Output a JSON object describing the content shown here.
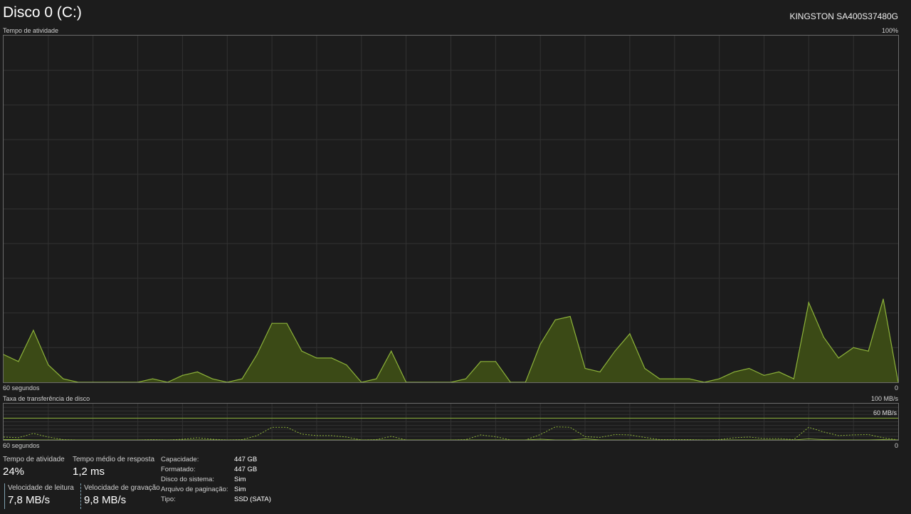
{
  "header": {
    "title": "Disco 0 (C:)",
    "model": "KINGSTON SA400S37480G"
  },
  "activity_chart": {
    "label": "Tempo de atividade",
    "max_label": "100%",
    "left_axis": "60 segundos",
    "right_axis": "0"
  },
  "transfer_chart": {
    "label": "Taxa de transferência de disco",
    "max_label": "100 MB/s",
    "ref_label": "60 MB/s",
    "left_axis": "60 segundos",
    "right_axis": "0"
  },
  "stats": {
    "activity_label": "Tempo de atividade",
    "activity_value": "24%",
    "response_label": "Tempo médio de resposta",
    "response_value": "1,2 ms",
    "read_label": "Velocidade de leitura",
    "read_value": "7,8 MB/s",
    "write_label": "Velocidade de gravação",
    "write_value": "9,8 MB/s"
  },
  "properties": [
    {
      "key": "Capacidade:",
      "value": "447 GB"
    },
    {
      "key": "Formatado:",
      "value": "447 GB"
    },
    {
      "key": "Disco do sistema:",
      "value": "Sim"
    },
    {
      "key": "Arquivo de paginação:",
      "value": "Sim"
    },
    {
      "key": "Tipo:",
      "value": "SSD (SATA)"
    }
  ],
  "colors": {
    "accent_line": "#8db33a",
    "accent_fill": "#3b4a16",
    "grid": "#323232",
    "background": "#1c1c1c"
  },
  "chart_data": [
    {
      "type": "area",
      "title": "Tempo de atividade",
      "xlabel": "60 segundos",
      "ylim": [
        0,
        100
      ],
      "x": [
        0,
        1,
        2,
        3,
        4,
        5,
        6,
        7,
        8,
        9,
        10,
        11,
        12,
        13,
        14,
        15,
        16,
        17,
        18,
        19,
        20,
        21,
        22,
        23,
        24,
        25,
        26,
        27,
        28,
        29,
        30,
        31,
        32,
        33,
        34,
        35,
        36,
        37,
        38,
        39,
        40,
        41,
        42,
        43,
        44,
        45,
        46,
        47,
        48,
        49,
        50,
        51,
        52,
        53,
        54,
        55,
        56,
        57,
        58,
        59,
        60
      ],
      "series": [
        {
          "values": [
            8,
            6,
            15,
            5,
            1,
            0,
            0,
            0,
            0,
            0,
            1,
            0,
            2,
            3,
            1,
            0,
            1,
            8,
            17,
            17,
            9,
            7,
            7,
            5,
            0,
            1,
            9,
            0,
            0,
            0,
            0,
            1,
            6,
            6,
            0,
            0,
            11,
            18,
            19,
            4,
            3,
            9,
            14,
            4,
            1,
            1,
            1,
            0,
            1,
            3,
            4,
            2,
            3,
            1,
            23,
            13,
            7,
            10,
            9,
            24,
            0
          ]
        }
      ]
    },
    {
      "type": "line",
      "title": "Taxa de transferência de disco",
      "xlabel": "60 segundos",
      "ylim": [
        0,
        100
      ],
      "reference_line": 60,
      "x": [
        0,
        1,
        2,
        3,
        4,
        5,
        6,
        7,
        8,
        9,
        10,
        11,
        12,
        13,
        14,
        15,
        16,
        17,
        18,
        19,
        20,
        21,
        22,
        23,
        24,
        25,
        26,
        27,
        28,
        29,
        30,
        31,
        32,
        33,
        34,
        35,
        36,
        37,
        38,
        39,
        40,
        41,
        42,
        43,
        44,
        45,
        46,
        47,
        48,
        49,
        50,
        51,
        52,
        53,
        54,
        55,
        56,
        57,
        58,
        59,
        60
      ],
      "series": [
        {
          "name": "Velocidade de leitura",
          "values": [
            1,
            1,
            0,
            0,
            0,
            0,
            0,
            0,
            0,
            0,
            0,
            0,
            0,
            0,
            0,
            0,
            0,
            0,
            0,
            0,
            0,
            0,
            0,
            0,
            0,
            0,
            0,
            0,
            0,
            0,
            0,
            0,
            0,
            0,
            0,
            0,
            2,
            0,
            0,
            3,
            0,
            0,
            0,
            0,
            0,
            0,
            0,
            0,
            0,
            0,
            0,
            0,
            0,
            0,
            3,
            1,
            0,
            0,
            0,
            1,
            0
          ]
        },
        {
          "name": "Velocidade de gravação",
          "values": [
            8,
            6,
            18,
            8,
            1,
            0,
            0,
            0,
            0,
            0,
            1,
            0,
            2,
            6,
            2,
            0,
            1,
            12,
            35,
            35,
            16,
            12,
            12,
            8,
            0,
            1,
            10,
            0,
            0,
            0,
            0,
            1,
            14,
            9,
            0,
            0,
            15,
            36,
            35,
            9,
            7,
            15,
            14,
            7,
            1,
            1,
            1,
            0,
            1,
            6,
            8,
            4,
            4,
            1,
            35,
            22,
            12,
            14,
            15,
            6,
            0
          ]
        }
      ]
    }
  ]
}
